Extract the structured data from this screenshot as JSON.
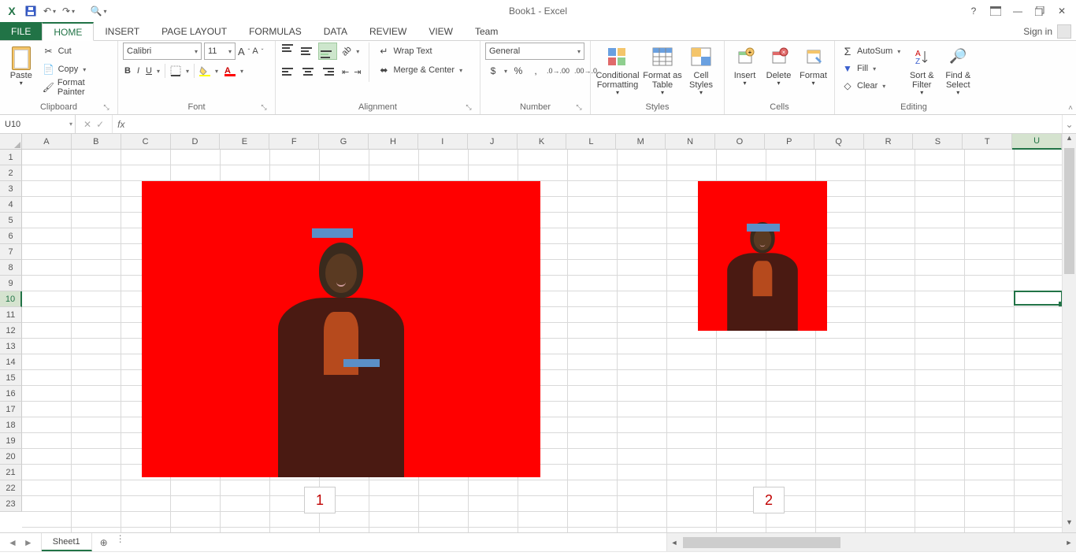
{
  "window": {
    "title": "Book1 - Excel",
    "signin": "Sign in"
  },
  "qat": {
    "save_tip": "Save",
    "undo_tip": "Undo",
    "redo_tip": "Redo",
    "preview_tip": "Print Preview"
  },
  "tabs": {
    "file": "FILE",
    "home": "HOME",
    "insert": "INSERT",
    "page_layout": "PAGE LAYOUT",
    "formulas": "FORMULAS",
    "data": "DATA",
    "review": "REVIEW",
    "view": "VIEW",
    "team": "Team"
  },
  "ribbon": {
    "clipboard": {
      "label": "Clipboard",
      "paste": "Paste",
      "cut": "Cut",
      "copy": "Copy",
      "format_painter": "Format Painter"
    },
    "font": {
      "label": "Font",
      "name": "Calibri",
      "size": "11",
      "bold": "B",
      "italic": "I",
      "underline": "U"
    },
    "alignment": {
      "label": "Alignment",
      "wrap": "Wrap Text",
      "merge": "Merge & Center"
    },
    "number": {
      "label": "Number",
      "format": "General"
    },
    "styles": {
      "label": "Styles",
      "cond": "Conditional Formatting",
      "table": "Format as Table",
      "cell": "Cell Styles"
    },
    "cells": {
      "label": "Cells",
      "insert": "Insert",
      "delete": "Delete",
      "format": "Format"
    },
    "editing": {
      "label": "Editing",
      "autosum": "AutoSum",
      "fill": "Fill",
      "clear": "Clear",
      "sort": "Sort & Filter",
      "find": "Find & Select"
    }
  },
  "formula_bar": {
    "name_box": "U10",
    "fx": "fx",
    "value": ""
  },
  "grid": {
    "columns": [
      "A",
      "B",
      "C",
      "D",
      "E",
      "F",
      "G",
      "H",
      "I",
      "J",
      "K",
      "L",
      "M",
      "N",
      "O",
      "P",
      "Q",
      "R",
      "S",
      "T",
      "U"
    ],
    "rows": [
      "1",
      "2",
      "3",
      "4",
      "5",
      "6",
      "7",
      "8",
      "9",
      "10",
      "11",
      "12",
      "13",
      "14",
      "15",
      "16",
      "17",
      "18",
      "19",
      "20",
      "21",
      "22",
      "23"
    ],
    "selected_col": "U",
    "selected_row": "10",
    "labels": {
      "one": "1",
      "two": "2"
    }
  },
  "sheet_tabs": {
    "sheet1": "Sheet1"
  }
}
